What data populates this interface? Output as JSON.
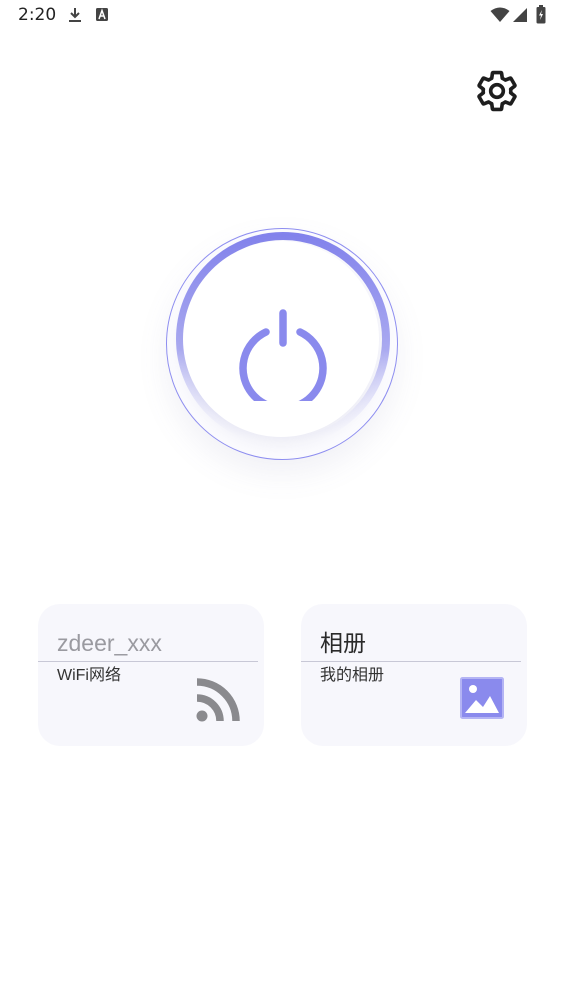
{
  "status_bar": {
    "time": "2:20",
    "icons": [
      "download-icon",
      "a-letter-icon",
      "wifi-icon",
      "signal-icon",
      "battery-charging-icon"
    ]
  },
  "settings": {
    "icon": "gear-icon"
  },
  "power": {
    "icon": "power-icon",
    "accent_color": "#8a8aed"
  },
  "cards": [
    {
      "title": "zdeer_xxx",
      "subtitle": "WiFi网络",
      "icon": "wifi-feed-icon"
    },
    {
      "title": "相册",
      "subtitle": "我的相册",
      "icon": "image-icon"
    }
  ],
  "colors": {
    "accent": "#8a8aed",
    "card_background": "#f7f7fc",
    "icon_gray": "#8a8a8e"
  }
}
